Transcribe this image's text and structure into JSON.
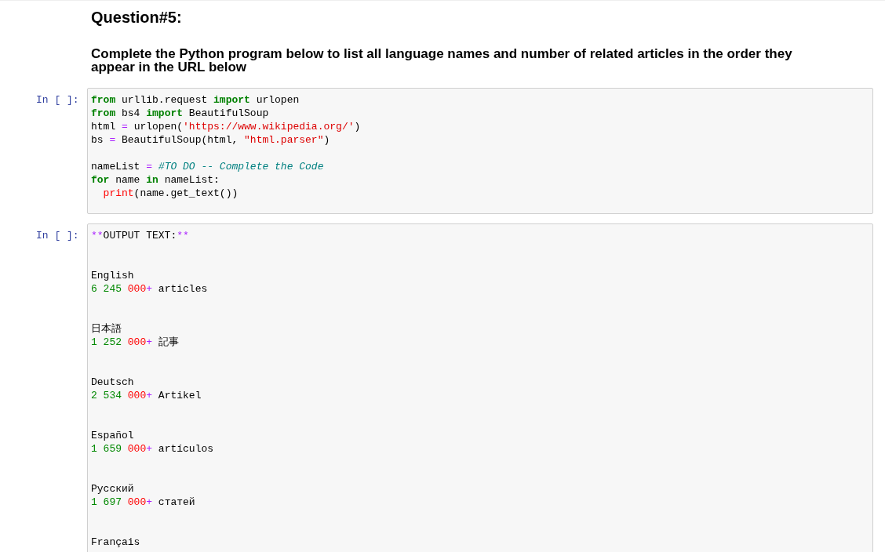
{
  "question_title": "Question#5:",
  "instructions": "Complete the Python program below to list all language names and number of related articles in the order they appear in the URL below",
  "cells": [
    {
      "prompt": "In [ ]:",
      "blocks": [
        [
          [
            {
              "text": "from",
              "kind": "keyword"
            },
            {
              "text": " urllib.request ",
              "kind": "plain"
            },
            {
              "text": "import",
              "kind": "keyword"
            },
            {
              "text": " urlopen",
              "kind": "plain"
            }
          ],
          [
            {
              "text": "from",
              "kind": "keyword"
            },
            {
              "text": " bs4 ",
              "kind": "plain"
            },
            {
              "text": "import",
              "kind": "keyword"
            },
            {
              "text": " BeautifulSoup",
              "kind": "plain"
            }
          ],
          [
            {
              "text": "html ",
              "kind": "plain"
            },
            {
              "text": "=",
              "kind": "operator"
            },
            {
              "text": " urlopen(",
              "kind": "plain"
            },
            {
              "text": "'https://www.wikipedia.org/'",
              "kind": "string"
            },
            {
              "text": ")",
              "kind": "plain"
            }
          ],
          [
            {
              "text": "bs ",
              "kind": "plain"
            },
            {
              "text": "=",
              "kind": "operator"
            },
            {
              "text": " BeautifulSoup(html, ",
              "kind": "plain"
            },
            {
              "text": "\"html.parser\"",
              "kind": "string"
            },
            {
              "text": ")",
              "kind": "plain"
            }
          ]
        ],
        [
          [
            {
              "text": "nameList ",
              "kind": "plain"
            },
            {
              "text": "=",
              "kind": "operator"
            },
            {
              "text": " #TO DO -- Complete the Code",
              "kind": "comment"
            }
          ],
          [
            {
              "text": "for",
              "kind": "keyword"
            },
            {
              "text": " name ",
              "kind": "plain"
            },
            {
              "text": "in",
              "kind": "keyword"
            },
            {
              "text": " nameList:",
              "kind": "plain"
            }
          ],
          [
            {
              "text": "  print",
              "kind": "builtin"
            },
            {
              "text": "(name.get_text())",
              "kind": "plain"
            }
          ]
        ]
      ]
    },
    {
      "prompt": "In [ ]:",
      "blocks": [
        [
          [
            {
              "text": "**",
              "kind": "operator"
            },
            {
              "text": "OUTPUT TEXT:",
              "kind": "plain"
            },
            {
              "text": "**",
              "kind": "operator"
            }
          ]
        ],
        [
          [
            {
              "text": "English",
              "kind": "plain"
            }
          ],
          [
            {
              "text": "6 245 ",
              "kind": "number"
            },
            {
              "text": "000",
              "kind": "builtin"
            },
            {
              "text": "+",
              "kind": "operator"
            },
            {
              "text": " articles",
              "kind": "plain"
            }
          ]
        ],
        [
          [
            {
              "text": "日本語",
              "kind": "plain"
            }
          ],
          [
            {
              "text": "1 252 ",
              "kind": "number"
            },
            {
              "text": "000",
              "kind": "builtin"
            },
            {
              "text": "+",
              "kind": "operator"
            },
            {
              "text": " 記事",
              "kind": "plain"
            }
          ]
        ],
        [
          [
            {
              "text": "Deutsch",
              "kind": "plain"
            }
          ],
          [
            {
              "text": "2 534 ",
              "kind": "number"
            },
            {
              "text": "000",
              "kind": "builtin"
            },
            {
              "text": "+",
              "kind": "operator"
            },
            {
              "text": " Artikel",
              "kind": "plain"
            }
          ]
        ],
        [
          [
            {
              "text": "Español",
              "kind": "plain"
            }
          ],
          [
            {
              "text": "1 659 ",
              "kind": "number"
            },
            {
              "text": "000",
              "kind": "builtin"
            },
            {
              "text": "+",
              "kind": "operator"
            },
            {
              "text": " artículos",
              "kind": "plain"
            }
          ]
        ],
        [
          [
            {
              "text": "Русский",
              "kind": "plain"
            }
          ],
          [
            {
              "text": "1 697 ",
              "kind": "number"
            },
            {
              "text": "000",
              "kind": "builtin"
            },
            {
              "text": "+",
              "kind": "operator"
            },
            {
              "text": " статей",
              "kind": "plain"
            }
          ]
        ],
        [
          [
            {
              "text": "Français",
              "kind": "plain"
            }
          ]
        ]
      ]
    }
  ]
}
